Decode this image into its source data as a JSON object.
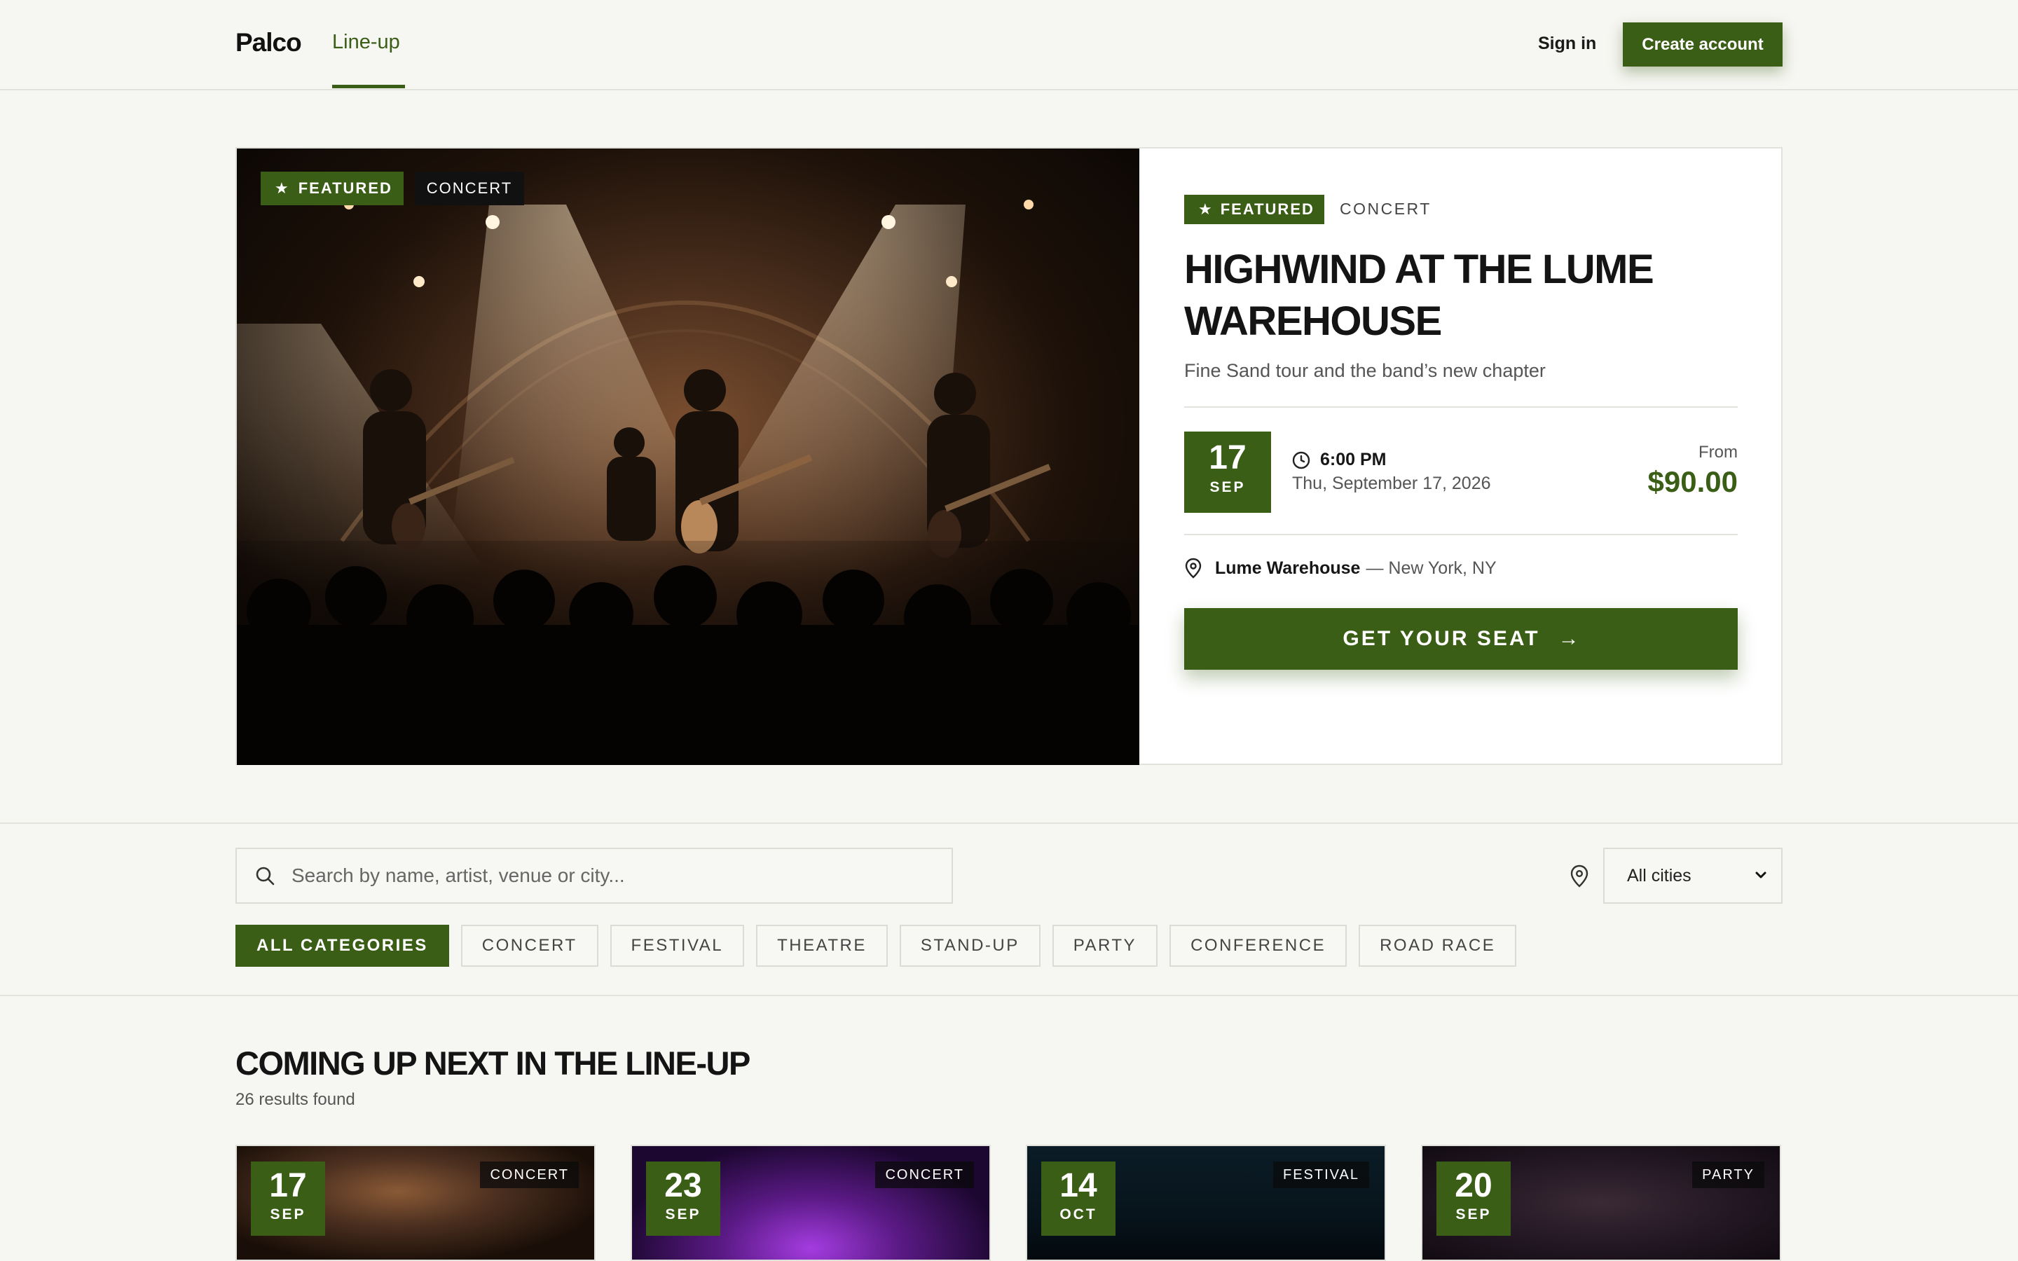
{
  "header": {
    "logo": "Palco",
    "nav_active": "Line-up",
    "sign_in": "Sign in",
    "create_account": "Create account"
  },
  "featured": {
    "badge": "FEATURED",
    "category": "CONCERT",
    "title": "HIGHWIND AT THE LUME WAREHOUSE",
    "subtitle": "Fine Sand tour and the band’s new chapter",
    "day": "17",
    "month": "SEP",
    "time": "6:00 PM",
    "date_full": "Thu, September 17, 2026",
    "from_label": "From",
    "price": "$90.00",
    "venue": "Lume Warehouse",
    "city": "— New York, NY",
    "cta": "GET YOUR SEAT",
    "cta_icon": "arrow-right-icon"
  },
  "filters": {
    "search_placeholder": "Search by name, artist, venue or city...",
    "city_select": "All cities",
    "categories": [
      "ALL CATEGORIES",
      "CONCERT",
      "FESTIVAL",
      "THEATRE",
      "STAND-UP",
      "PARTY",
      "CONFERENCE",
      "ROAD RACE"
    ],
    "active_category": "ALL CATEGORIES"
  },
  "results": {
    "title": "COMING UP NEXT IN THE LINE-UP",
    "count": "26 results found",
    "cards": [
      {
        "day": "17",
        "month": "SEP",
        "category": "CONCERT"
      },
      {
        "day": "23",
        "month": "SEP",
        "category": "CONCERT"
      },
      {
        "day": "14",
        "month": "OCT",
        "category": "FESTIVAL"
      },
      {
        "day": "20",
        "month": "SEP",
        "category": "PARTY"
      }
    ]
  },
  "colors": {
    "accent": "#3b5e16",
    "background": "#f6f6f2",
    "text": "#161616"
  }
}
